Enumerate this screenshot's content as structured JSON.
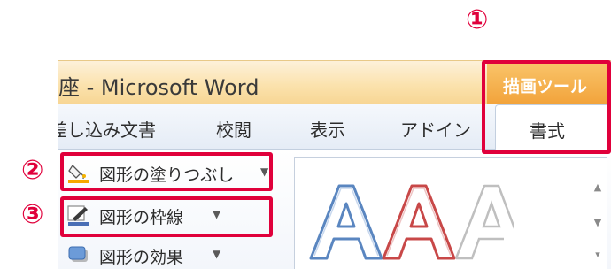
{
  "window": {
    "title": "座 - Microsoft Word",
    "context_header": "描画ツール",
    "tabs": [
      {
        "label": "差し込み文書"
      },
      {
        "label": "校閲"
      },
      {
        "label": "表示"
      },
      {
        "label": "アドイン"
      }
    ],
    "active_tab": "書式"
  },
  "ribbon": {
    "commands": [
      {
        "label": "図形の塗りつぶし",
        "icon": "paint-bucket-icon"
      },
      {
        "label": "図形の枠線",
        "icon": "pencil-outline-icon"
      },
      {
        "label": "図形の効果",
        "icon": "shape-effects-icon"
      }
    ],
    "gallery": {
      "styles": [
        {
          "letter": "A",
          "fill": "#ffffff",
          "outline": "#5a86c0"
        },
        {
          "letter": "A",
          "fill": "#ffffff",
          "outline": "#c84848"
        },
        {
          "letter": "A",
          "fill": "#ffffff",
          "outline": "#bfbfbf"
        }
      ]
    }
  },
  "annotations": {
    "marker_1": "①",
    "marker_2": "②",
    "marker_3": "③",
    "color": "#e0003b"
  }
}
